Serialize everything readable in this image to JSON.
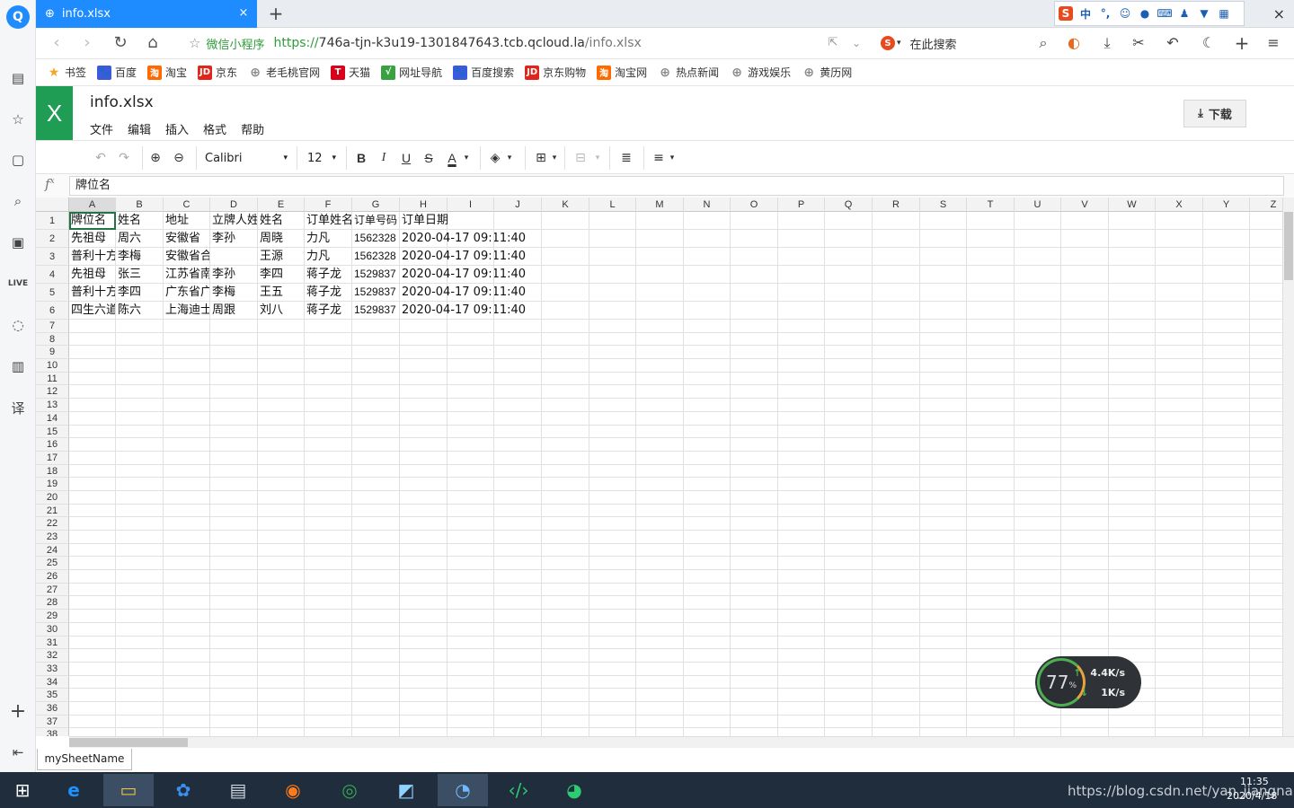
{
  "browser": {
    "tab_title": "info.xlsx",
    "tab_close": "×",
    "new_tab": "+",
    "ime": [
      "中",
      "°,"
    ],
    "window_close": "×",
    "miniprogram_label": "微信小程序",
    "url_https": "https://",
    "url_host": "746a-tjn-k3u19-1301847643.tcb.qcloud.la",
    "url_path": "/info.xlsx",
    "search_placeholder": "在此搜索"
  },
  "bookmarks": [
    {
      "label": "书签",
      "icon": "star-icon",
      "color": "#f5a623"
    },
    {
      "label": "百度",
      "icon": "paw-icon",
      "color": "#3b5bdb"
    },
    {
      "label": "淘宝",
      "icon": "taobao-icon",
      "color": "#ff6a00"
    },
    {
      "label": "京东",
      "icon": "jd-icon",
      "color": "#e1251b"
    },
    {
      "label": "老毛桃官网",
      "icon": "globe-icon",
      "color": "#888888"
    },
    {
      "label": "天猫",
      "icon": "tmall-icon",
      "color": "#d9001b"
    },
    {
      "label": "网址导航",
      "icon": "hao-icon",
      "color": "#3aa141"
    },
    {
      "label": "百度搜索",
      "icon": "paw-icon",
      "color": "#3b5bdb"
    },
    {
      "label": "京东购物",
      "icon": "jd-icon",
      "color": "#e1251b"
    },
    {
      "label": "淘宝网",
      "icon": "taobao-icon",
      "color": "#ff6a00"
    },
    {
      "label": "热点新闻",
      "icon": "globe-icon",
      "color": "#888888"
    },
    {
      "label": "游戏娱乐",
      "icon": "globe-icon",
      "color": "#888888"
    },
    {
      "label": "黄历网",
      "icon": "globe-icon",
      "color": "#888888"
    }
  ],
  "bookmark_glyphs": [
    "★",
    "🐾",
    "淘",
    "JD",
    "⊕",
    "T",
    "√",
    "🐾",
    "JD",
    "淘",
    "⊕",
    "⊕",
    "⊕"
  ],
  "app": {
    "logo": "X",
    "doc_title": "info.xlsx",
    "menus": [
      "文件",
      "编辑",
      "插入",
      "格式",
      "帮助"
    ],
    "download_label": "下载",
    "font_name": "Calibri",
    "font_size": "12",
    "bold": "B",
    "italic": "I",
    "underline": "U",
    "strike": "S",
    "font_color": "A",
    "formula_prefix": "f",
    "formula_sup": "x",
    "formula_value": "牌位名",
    "sheet_tab": "mySheetName"
  },
  "grid": {
    "columns": [
      "A",
      "B",
      "C",
      "D",
      "E",
      "F",
      "G",
      "H",
      "I",
      "J",
      "K",
      "L",
      "M",
      "N",
      "O",
      "P",
      "Q",
      "R",
      "S",
      "T",
      "U",
      "V",
      "W",
      "X",
      "Y",
      "Z"
    ],
    "rows": [
      [
        "牌位名",
        "姓名",
        "地址",
        "立牌人姓",
        "姓名",
        "订单姓名",
        "订单号码",
        "订单日期"
      ],
      [
        "先祖母",
        "周六",
        "安徽省",
        "李孙",
        "周晓",
        "力凡",
        "1562328",
        "2020-04-17 09:11:40"
      ],
      [
        "普利十方",
        "李梅",
        "安徽省合",
        "",
        "王源",
        "力凡",
        "1562328",
        "2020-04-17 09:11:40"
      ],
      [
        "先祖母",
        "张三",
        "江苏省南",
        "李孙",
        "李四",
        "蒋子龙",
        "1529837",
        "2020-04-17 09:11:40"
      ],
      [
        "普利十方",
        "李四",
        "广东省广",
        "李梅",
        "王五",
        "蒋子龙",
        "1529837",
        "2020-04-17 09:11:40"
      ],
      [
        "四生六道",
        "陈六",
        "上海迪士",
        "周跟",
        "刘八",
        "蒋子龙",
        "1529837",
        "2020-04-17 09:11:40"
      ]
    ],
    "row_numbers": [
      "1",
      "2",
      "3",
      "4",
      "5",
      "6",
      "7",
      "8",
      "9",
      "10",
      "11",
      "12",
      "13",
      "14",
      "15",
      "16",
      "17",
      "18",
      "19",
      "20",
      "21",
      "22",
      "23",
      "24",
      "25",
      "26",
      "27",
      "28",
      "29",
      "30",
      "31",
      "32",
      "33",
      "34",
      "35",
      "36",
      "37",
      "38"
    ]
  },
  "net_widget": {
    "cpu": "77",
    "unit": "%",
    "up": "4.4K/s",
    "down": "1K/s"
  },
  "taskbar": {
    "tray_text": "https://blog.csdn.net/yan_jiangnan",
    "time": "11:35",
    "date": "2020/4/18"
  }
}
